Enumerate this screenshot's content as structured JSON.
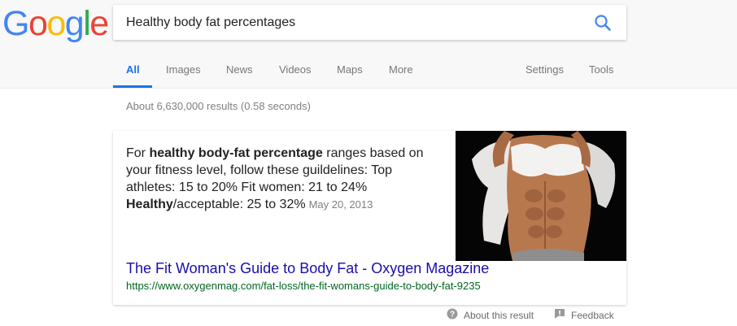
{
  "logo": {
    "letters": [
      "G",
      "o",
      "o",
      "g",
      "l",
      "e"
    ],
    "colors": [
      "#4285f4",
      "#ea4335",
      "#fbbc05",
      "#4285f4",
      "#34a853",
      "#ea4335"
    ]
  },
  "search": {
    "query": "Healthy body fat percentages",
    "icon": "search-icon"
  },
  "tabs": [
    {
      "label": "All",
      "active": true
    },
    {
      "label": "Images"
    },
    {
      "label": "News"
    },
    {
      "label": "Videos"
    },
    {
      "label": "Maps"
    },
    {
      "label": "More"
    },
    {
      "label": "Settings"
    },
    {
      "label": "Tools"
    }
  ],
  "results_count": "About 6,630,000 results (0.58 seconds)",
  "featured": {
    "snippet_parts": [
      "For ",
      "healthy body-fat percentage",
      " ranges based on your fitness level, follow these guildelines: Top athletes: 15 to 20% Fit women: 21 to 24% ",
      "Healthy",
      "/acceptable: 25 to 32%"
    ],
    "date": "May 20, 2013",
    "title": "The Fit Woman's Guide to Body Fat - Oxygen Magazine",
    "url": "https://www.oxygenmag.com/fat-loss/the-fit-womans-guide-to-body-fat-9235",
    "image_alt": "woman-abs-photo"
  },
  "footer": {
    "about": "About this result",
    "feedback": "Feedback",
    "about_icon": "help-circle-icon",
    "feedback_icon": "feedback-icon"
  },
  "colors": {
    "link": "#1a0dab",
    "url": "#006621",
    "accent": "#1a73e8"
  }
}
